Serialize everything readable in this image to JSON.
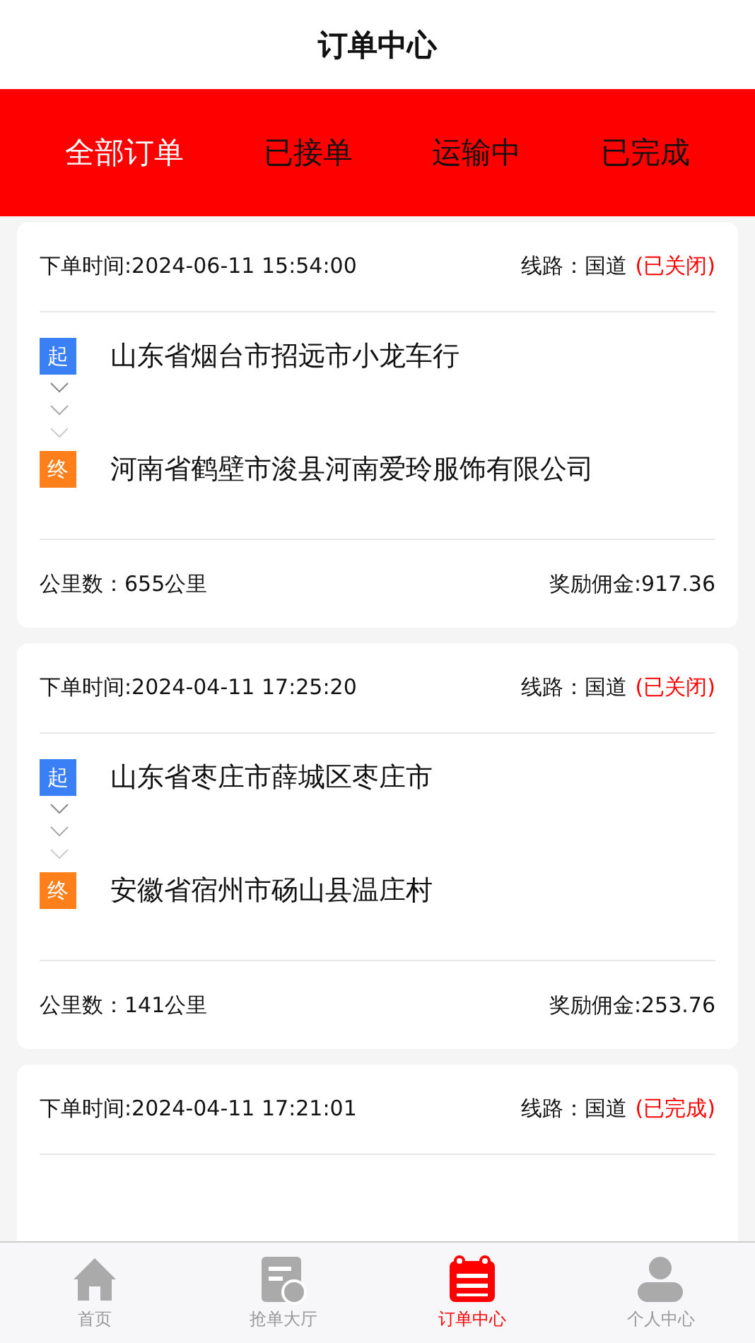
{
  "header": {
    "title": "订单中心"
  },
  "tabs": [
    {
      "label": "全部订单",
      "selected": true
    },
    {
      "label": "已接单",
      "selected": false
    },
    {
      "label": "运输中",
      "selected": false
    },
    {
      "label": "已完成",
      "selected": false
    }
  ],
  "orders": [
    {
      "time": "下单时间:2024-06-11 15:54:00",
      "route": "线路：国道",
      "status": "(已关闭)",
      "from_badge": "起",
      "from": "山东省烟台市招远市小龙车行",
      "to_badge": "终",
      "to": "河南省鹤壁市浚县河南爱玲服饰有限公司",
      "distance": "公里数：655公里",
      "reward": "奖励佣金:917.36"
    },
    {
      "time": "下单时间:2024-04-11 17:25:20",
      "route": "线路：国道",
      "status": "(已关闭)",
      "from_badge": "起",
      "from": "山东省枣庄市薛城区枣庄市",
      "to_badge": "终",
      "to": "安徽省宿州市砀山县温庄村",
      "distance": "公里数：141公里",
      "reward": "奖励佣金:253.76"
    },
    {
      "time": "下单时间:2024-04-11 17:21:01",
      "route": "线路：国道",
      "status": "(已完成)"
    }
  ],
  "nav": [
    {
      "label": "首页",
      "kind": "home",
      "selected": false
    },
    {
      "label": "抢单大厅",
      "kind": "hall",
      "selected": false
    },
    {
      "label": "订单中心",
      "kind": "orders",
      "selected": true
    },
    {
      "label": "个人中心",
      "kind": "person",
      "selected": false
    }
  ]
}
